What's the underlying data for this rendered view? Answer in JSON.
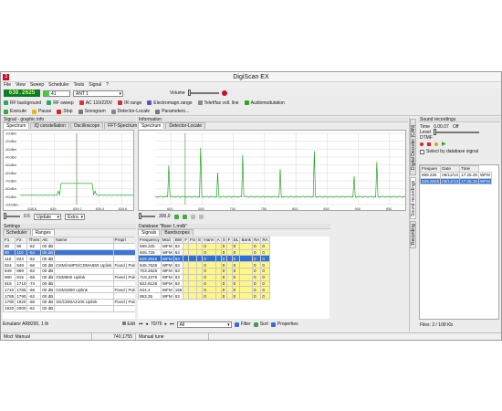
{
  "app": {
    "title": "DigiScan EX"
  },
  "menu": [
    "File",
    "View",
    "Sweep",
    "Scheduler",
    "Tests",
    "Signal",
    "?"
  ],
  "toolbar": {
    "frequency": "639.2625",
    "step_value": "41",
    "antenna": "ANT 1",
    "volume_label": "Volume"
  },
  "toolbar2": [
    "RF background",
    "RF sweep",
    "AC 110/220V",
    "IR range",
    "Electromagn.range",
    "Telef/fax voll. line",
    "Audiomodulation"
  ],
  "toolbar3": [
    "Execute",
    "Pause",
    "Stop",
    "Sonogram",
    "Detector-Locate",
    "Parameters..."
  ],
  "signal_panel": {
    "header": "Signal - graphic info",
    "tabs": [
      "Spectrum",
      "IQ constellation",
      "Oscilloscope",
      "FFT-Spectrum"
    ],
    "ylabels": [
      "-10dBm",
      "-20dBm",
      "-30dBm",
      "-40dBm",
      "-50dBm",
      "-60dBm",
      "-70dBm",
      "-80dBm",
      "-90dBm",
      "-100dBm"
    ],
    "xlabels": [
      "638.8",
      "639",
      "639.2",
      "639.4",
      "639.6"
    ],
    "span_value": "0.5",
    "update_label": "Update",
    "mode_label": "Extra"
  },
  "info_panel": {
    "header": "Information",
    "tabs": [
      "Spectrum",
      "Detector-Locate"
    ],
    "xlabels": [
      "600",
      "650",
      "700",
      "750",
      "800",
      "850",
      "900",
      "950"
    ],
    "span_value": "300,0"
  },
  "settings": {
    "header": "Settings",
    "tabs": [
      "Scheduler",
      "Ranges"
    ],
    "columns": [
      "F1",
      "F2",
      "Thres",
      "Att",
      "Name",
      "Propri"
    ],
    "rows": [
      [
        "80",
        "90",
        "-62",
        "00 dB",
        "",
        ""
      ],
      [
        "90",
        "110",
        "-54",
        "00 dB",
        "",
        ""
      ],
      [
        "110",
        "824",
        "-62",
        "00 dB",
        "",
        ""
      ],
      [
        "824",
        "849",
        "-66",
        "00 dB",
        "GSM/AMPS/CDMA850 Uplink",
        "Fixed | Pulse"
      ],
      [
        "849",
        "869",
        "-62",
        "00 dB",
        "",
        ""
      ],
      [
        "880",
        "915",
        "-66",
        "00 dB",
        "GSM900 Uplink",
        "Fixed | Pulse"
      ],
      [
        "915",
        "1710",
        "-74",
        "00 dB",
        "",
        ""
      ],
      [
        "1710",
        "1785",
        "-66",
        "00 dB",
        "GSM1800 Uplink",
        "Fixed | Pulse"
      ],
      [
        "1785",
        "1790",
        "-62",
        "00 dB",
        "",
        ""
      ],
      [
        "1790",
        "1920",
        "-66",
        "00 dB",
        "3G/CDMA2100 Uplink",
        "Fixed | Pulse"
      ],
      [
        "1920",
        "2000",
        "-62",
        "00 dB",
        "",
        ""
      ]
    ],
    "selected_row": 1,
    "device": "Emulator AR8200, 1 th",
    "edit_label": "Edit"
  },
  "database": {
    "header": "Database \"Base 1.mdb\"",
    "tabs": [
      "Signals",
      "Bandscopes"
    ],
    "columns": [
      "Frequency",
      "Mod",
      "BW",
      "F",
      "Fix",
      "E",
      "Harm",
      "A",
      "S",
      "F",
      "DL",
      "Bank",
      "RA",
      "RA"
    ],
    "rows": [
      [
        "599.225",
        "WFM",
        "63",
        "",
        "",
        "",
        "0",
        "",
        "0",
        "",
        "0",
        "",
        "0",
        "0"
      ],
      [
        "605.725",
        "WFM",
        "63",
        "",
        "",
        "",
        "0",
        "",
        "0",
        "",
        "0",
        "",
        "0",
        "0"
      ],
      [
        "639.2625",
        "WFM",
        "63",
        "",
        "",
        "",
        "0",
        "",
        "0",
        "",
        "0",
        "",
        "0",
        "0"
      ],
      [
        "645.7625",
        "WFM",
        "63",
        "",
        "",
        "",
        "0",
        "",
        "0",
        "",
        "0",
        "",
        "0",
        "0"
      ],
      [
        "703.2625",
        "WFM",
        "63",
        "",
        "",
        "",
        "0",
        "",
        "0",
        "",
        "0",
        "",
        "0",
        "0"
      ],
      [
        "719.2375",
        "WFM",
        "63",
        "",
        "",
        "",
        "0",
        "",
        "0",
        "",
        "0",
        "",
        "0",
        "0"
      ],
      [
        "822.8125",
        "WFM",
        "63",
        "",
        "",
        "",
        "0",
        "",
        "0",
        "",
        "0",
        "",
        "0",
        "0"
      ],
      [
        "944.4",
        "WFM",
        "158",
        "",
        "",
        "",
        "0",
        "",
        "0",
        "",
        "0",
        "",
        "0",
        "0"
      ],
      [
        "953.35",
        "WFM",
        "63",
        "",
        "",
        "",
        "0",
        "",
        "0",
        "",
        "0",
        "",
        "0",
        "0"
      ]
    ],
    "selected_row": 2,
    "counter": "70/76",
    "filter_value": "All",
    "buttons": [
      "Filter",
      "Sort",
      "Properties"
    ]
  },
  "sound": {
    "header": "Sound recordings",
    "time_label": "Time",
    "time_value": "0.00.07",
    "off_label": "Off",
    "level_label": "Level",
    "level_value": "DTMF",
    "select_label": "Select by database signal",
    "columns": [
      "Frequen",
      "Date",
      "Time"
    ],
    "rows": [
      [
        "599.225",
        "06/12/13",
        "17:25.25",
        "WFM"
      ],
      [
        "639.2625",
        "06/12/13",
        "17:25.25",
        "WFM"
      ]
    ],
    "files": "Files: 2 / 108 Kb"
  },
  "vtabs": [
    "Digital Decoder (CAN)",
    "Sound recordings",
    "Recording"
  ],
  "status": {
    "mode": "Mod: Manual",
    "freq": "740.1755",
    "tune": "Manual tune"
  }
}
